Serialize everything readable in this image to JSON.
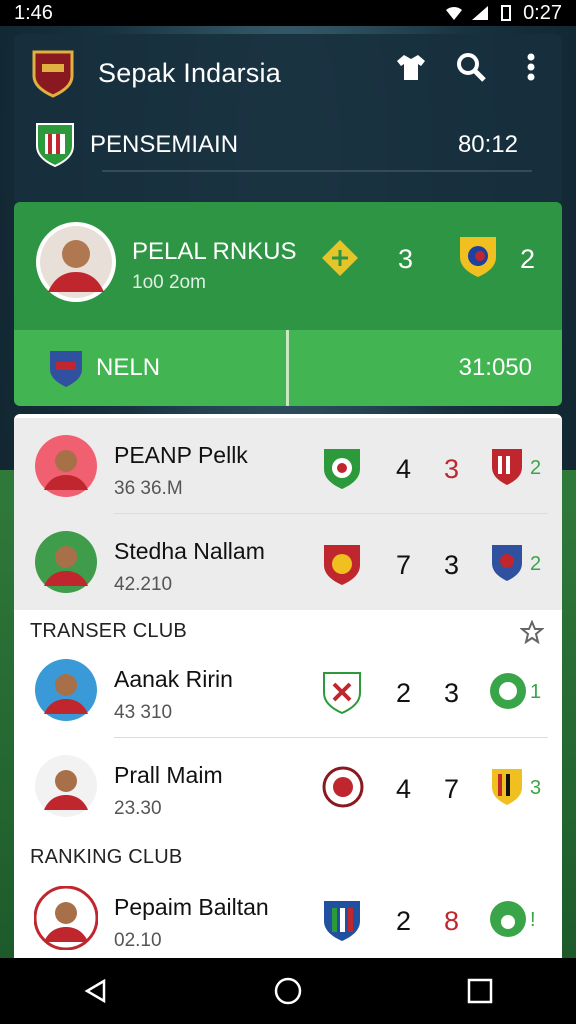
{
  "status": {
    "time": "1:46",
    "clock": "0:27"
  },
  "app": {
    "title": "Sepak Indarsia"
  },
  "hero": {
    "name": "PENSEMIAIN",
    "score": "80:12"
  },
  "featured": {
    "name": "PELAL RNKUS",
    "meta": "1o0 2om",
    "score_home": "3",
    "score_away": "2"
  },
  "match": {
    "label": "NELN",
    "time": "31:050"
  },
  "rows": [
    {
      "name": "PEANP Pellk",
      "meta": "36 36.M",
      "a": "4",
      "b": "3"
    },
    {
      "name": "Stedha Nallam",
      "meta": "42.210",
      "a": "7",
      "b": "3"
    },
    {
      "name": "Aanak Ririn",
      "meta": "43 310",
      "a": "2",
      "b": "3"
    },
    {
      "name": "Prall Maim",
      "meta": "23.30",
      "a": "4",
      "b": "7"
    },
    {
      "name": "Pepaim Bailtan",
      "meta": "02.10",
      "a": "2",
      "b": "8"
    }
  ],
  "row_suffix": [
    "2",
    "2",
    "1",
    "3",
    "!"
  ],
  "sections": {
    "transfer": "TRANSER CLUB",
    "ranking": "RANKING CLUB"
  },
  "colors": {
    "green_dark": "#2d9543",
    "green_light": "#42b552",
    "score_red": "#c0262d"
  }
}
